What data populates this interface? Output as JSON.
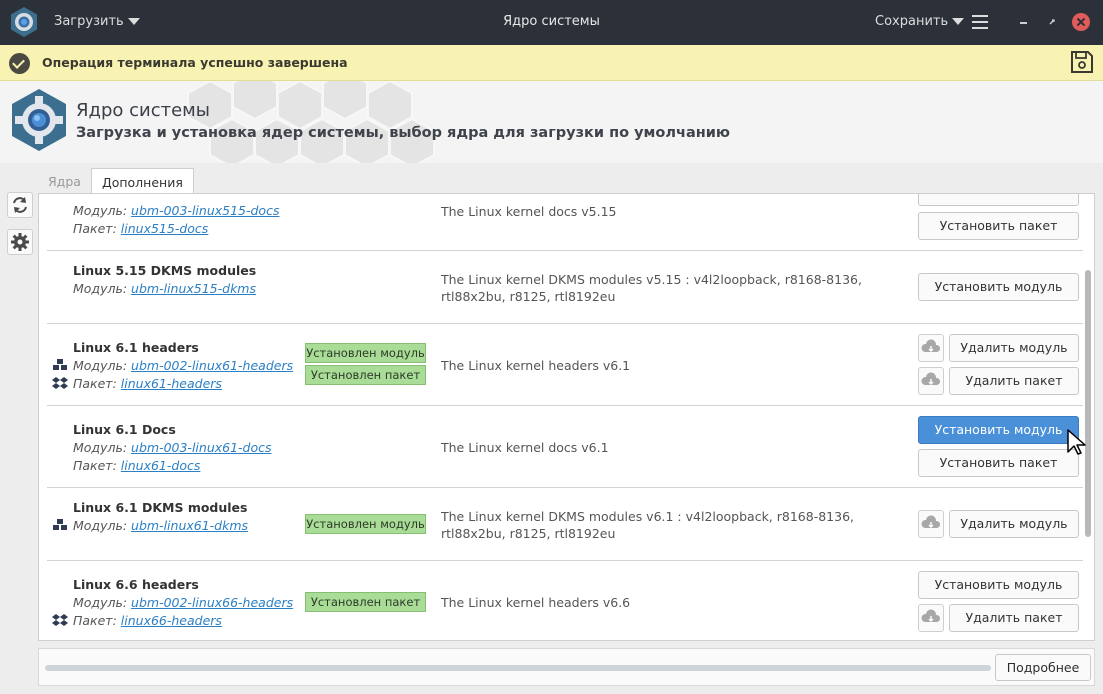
{
  "titlebar": {
    "load_label": "Загрузить",
    "title": "Ядро системы",
    "save_label": "Сохранить"
  },
  "notification": {
    "text": "Операция терминала успешно завершена"
  },
  "header": {
    "title": "Ядро системы",
    "subtitle": "Загрузка и установка ядер системы, выбор ядра для загрузки по умолчанию"
  },
  "tabs": [
    {
      "label": "Ядра",
      "active": false
    },
    {
      "label": "Дополнения",
      "active": true
    }
  ],
  "labels": {
    "module": "Модуль:",
    "package": "Пакет:"
  },
  "rows": [
    {
      "module": "ubm-003-linux515-docs",
      "package": "linux515-docs",
      "description": "The Linux kernel docs v5.15",
      "btn_install_package": "Установить пакет"
    },
    {
      "title": "Linux 5.15 DKMS modules",
      "module": "ubm-linux515-dkms",
      "description": "The Linux kernel DKMS modules v5.15 : v4l2loopback, r8168-8136, rtl88x2bu, r8125, rtl8192eu",
      "btn_install_module": "Установить модуль"
    },
    {
      "title": "Linux 6.1 headers",
      "module": "ubm-002-linux61-headers",
      "package": "linux61-headers",
      "badge_module": "Установлен модуль",
      "badge_package": "Установлен пакет",
      "description": "The Linux kernel headers v6.1",
      "btn_remove_module": "Удалить модуль",
      "btn_remove_package": "Удалить пакет"
    },
    {
      "title": "Linux 6.1 Docs",
      "module": "ubm-003-linux61-docs",
      "package": "linux61-docs",
      "description": "The Linux kernel docs v6.1",
      "btn_install_module": "Установить модуль",
      "btn_install_package": "Установить пакет"
    },
    {
      "title": "Linux 6.1 DKMS modules",
      "module": "ubm-linux61-dkms",
      "badge_module": "Установлен модуль",
      "description": "The Linux kernel DKMS modules v6.1 : v4l2loopback, r8168-8136, rtl88x2bu, r8125, rtl8192eu",
      "btn_remove_module": "Удалить модуль"
    },
    {
      "title": "Linux 6.6 headers",
      "module": "ubm-002-linux66-headers",
      "package": "linux66-headers",
      "badge_package": "Установлен пакет",
      "description": "The Linux kernel headers v6.6",
      "btn_install_module": "Установить модуль",
      "btn_remove_package": "Удалить пакет"
    }
  ],
  "bottom": {
    "more_label": "Подробнее"
  },
  "colors": {
    "titlebar_bg": "#2c3038",
    "notification_bg": "#f8f3b3",
    "badge_bg": "#a9dc97",
    "primary_button": "#4a90d9",
    "link": "#2b7fc5"
  },
  "icons": {
    "app": "gear-icon",
    "notification": "check-icon",
    "save": "floppy-disk-icon",
    "refresh": "refresh-icon",
    "settings": "gear-icon",
    "module": "cubes-icon",
    "package": "dropbox-icon",
    "download": "cloud-download-icon"
  }
}
